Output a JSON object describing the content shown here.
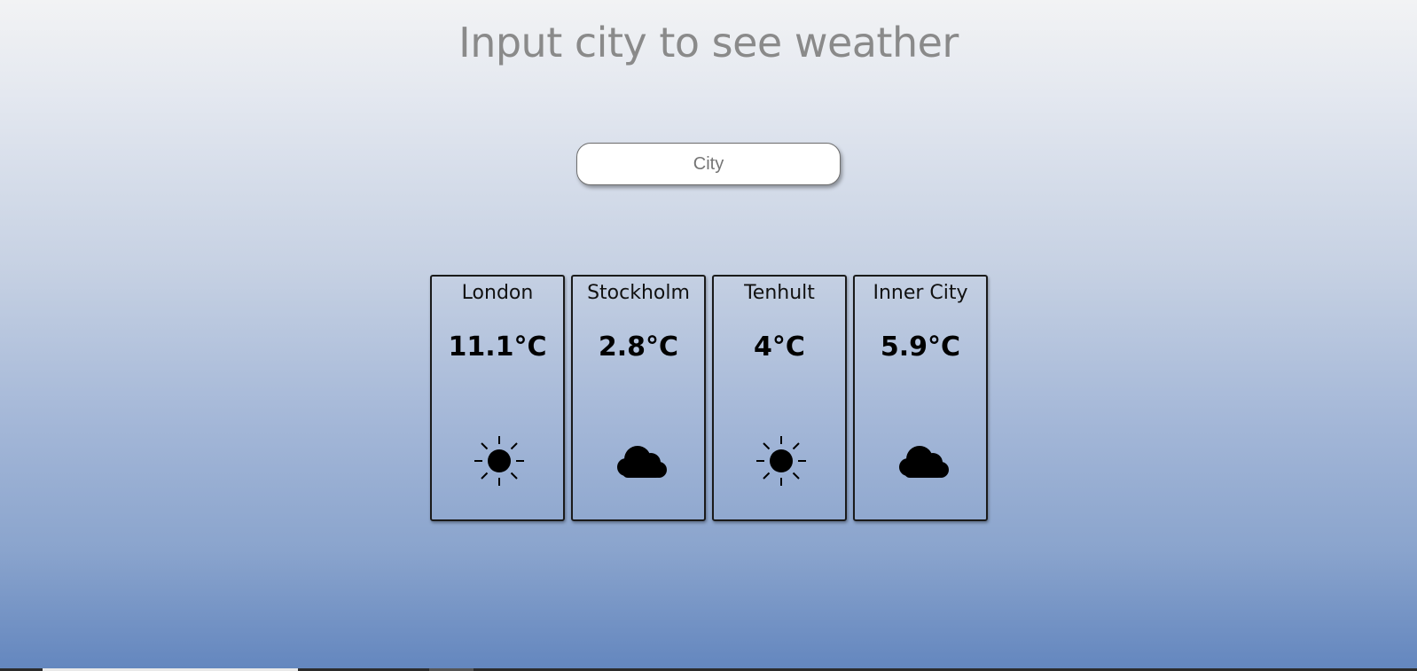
{
  "header": {
    "title": "Input city to see weather"
  },
  "search": {
    "placeholder": "City",
    "value": ""
  },
  "cards": [
    {
      "city": "London",
      "temperature": "11.1°C",
      "icon": "sun-icon"
    },
    {
      "city": "Stockholm",
      "temperature": "2.8°C",
      "icon": "cloud-icon"
    },
    {
      "city": "Tenhult",
      "temperature": "4°C",
      "icon": "sun-icon"
    },
    {
      "city": "Inner City",
      "temperature": "5.9°C",
      "icon": "cloud-icon"
    }
  ],
  "colors": {
    "title_text": "#8a8a8a",
    "gradient_top": "#f2f3f4",
    "gradient_bottom": "#6386be",
    "card_border": "#1a1a1a"
  }
}
